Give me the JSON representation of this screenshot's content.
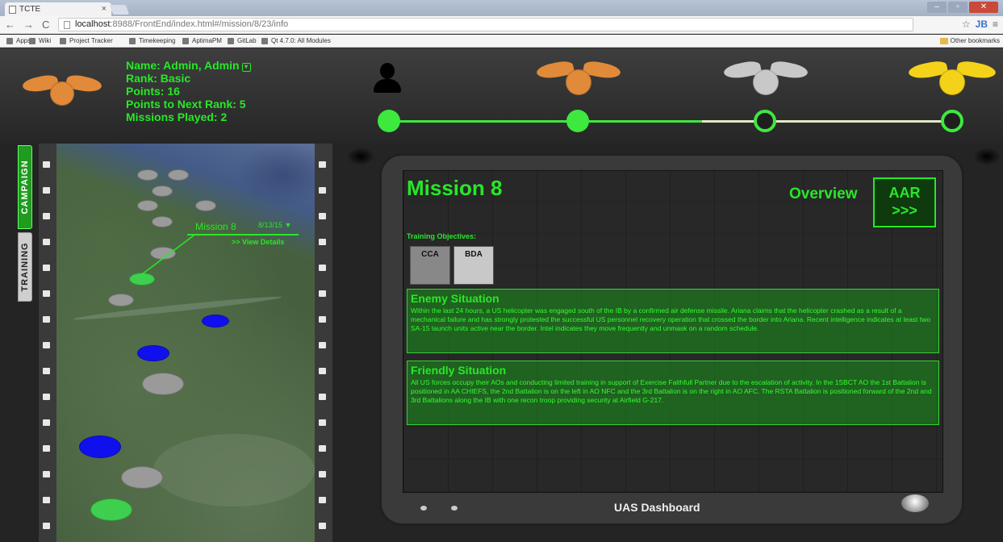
{
  "browser": {
    "tab_title": "TCTE",
    "url_host": "localhost",
    "url_rest": ":8988/FrontEnd/index.html#/mission/8/23/info",
    "bookmarks": [
      "Apps",
      "Wiki",
      "Project Tracker",
      "Timekeeping",
      "AptimaPM",
      "GitLab",
      "Qt 4.7.0: All Modules"
    ],
    "other_bookmarks": "Other bookmarks",
    "profile_initials": "JB"
  },
  "user": {
    "name_line": "Name: Admin, Admin",
    "rank_line": "Rank: Basic",
    "points_line": "Points: 16",
    "next_rank_line": "Points to Next Rank: 5",
    "missions_line": "Missions Played: 2"
  },
  "progress": {
    "ranks": [
      "none",
      "bronze",
      "silver",
      "gold"
    ],
    "achieved": [
      true,
      true,
      false,
      false
    ],
    "colors": {
      "accent": "#3ee83e",
      "bronze": "#e08a3a",
      "silver": "#c8c8c8",
      "gold": "#f4d21a"
    }
  },
  "sidebar": {
    "tabs": [
      {
        "label": "CAMPAIGN",
        "active": true
      },
      {
        "label": "TRAINING",
        "active": false
      }
    ]
  },
  "map": {
    "selected_mission": "Mission 8",
    "selected_date": "8/13/15 ▼",
    "details_link": ">> View Details",
    "marker_colors": {
      "grey": "#9a9a9a",
      "blue": "#1010ee",
      "green": "#3fcf4f"
    }
  },
  "mission": {
    "title": "Mission 8",
    "overview_label": "Overview",
    "aar_label": "AAR",
    "aar_arrows": ">>>",
    "objectives_label": "Training Objectives:",
    "objectives": [
      "CCA",
      "BDA"
    ],
    "enemy": {
      "heading": "Enemy Situation",
      "text": "Within the last 24 hours, a US helicopter was engaged south of the IB by a confirmed air defense missile. Ariana claims that the helicopter crashed as a result of a mechanical failure and has strongly protested the successful US personnel recovery operation that crossed the border into Ariana. Recent intelligence indicates at least two SA-15 launch units active near the border. Intel indicates they move frequently and unmask on a random schedule."
    },
    "friendly": {
      "heading": "Friendly Situation",
      "text": "All US forces occupy their AOs and conducting limited training in support of Exercise Faithfull Partner due to the escalation of activity. In the 1SBCT AO the 1st Battalion is positioned in AA CHIEFS, the 2nd Battalion is on the left in AO NFC and the 3rd Battalion is on the right in AO AFC. The RSTA Battalion is positioned forward of the 2nd and 3rd Battalions along the IB with one recon troop providing security at Airfield G-217."
    },
    "dashboard_label": "UAS Dashboard"
  }
}
